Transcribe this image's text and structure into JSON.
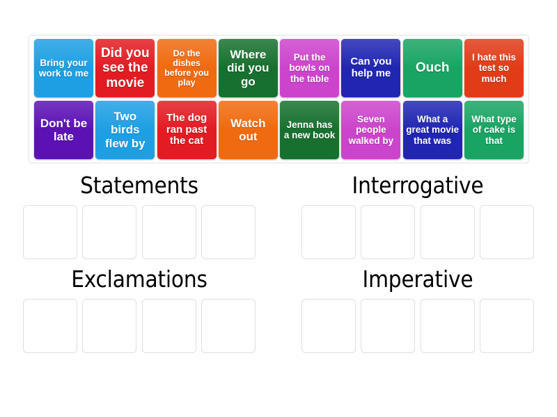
{
  "app": {
    "type": "group-sort-activity",
    "background_color": "#ffffff"
  },
  "tray": {
    "name": "answer-tile-tray",
    "rows": [
      [
        {
          "text": "Bring your work to me",
          "color": "#1e9fe3",
          "size": "fs-sm"
        },
        {
          "text": "Did you see the movie",
          "color": "#e31b23",
          "size": "fs-xl"
        },
        {
          "text": "Do the dishes before you play",
          "color": "#f06a0f",
          "size": "fs-xs"
        },
        {
          "text": "Where did you go",
          "color": "#17702f",
          "size": "fs-lg"
        },
        {
          "text": "Put the bowls on the table",
          "color": "#cc44cc",
          "size": "fs-sm"
        },
        {
          "text": "Can you help me",
          "color": "#2026b2",
          "size": "fs-md"
        },
        {
          "text": "Ouch",
          "color": "#19a463",
          "size": "fs-xl"
        },
        {
          "text": "I hate this test so much",
          "color": "#e13b17",
          "size": "fs-sm"
        }
      ],
      [
        {
          "text": "Don't be late",
          "color": "#5c11b5",
          "size": "fs-lg"
        },
        {
          "text": "Two birds flew by",
          "color": "#1e9fe3",
          "size": "fs-lg"
        },
        {
          "text": "The dog ran past the cat",
          "color": "#e31b23",
          "size": "fs-md"
        },
        {
          "text": "Watch out",
          "color": "#f06a0f",
          "size": "fs-lg"
        },
        {
          "text": "Jenna has a new book",
          "color": "#17702f",
          "size": "fs-sm"
        },
        {
          "text": "Seven people walked by",
          "color": "#cc44cc",
          "size": "fs-sm"
        },
        {
          "text": "What a great movie that was",
          "color": "#2026b2",
          "size": "fs-sm"
        },
        {
          "text": "What type of cake is that",
          "color": "#19a463",
          "size": "fs-sm"
        }
      ]
    ]
  },
  "groups": [
    {
      "title": "Statements",
      "slot_count": 4,
      "slots": [
        "",
        "",
        "",
        ""
      ]
    },
    {
      "title": "Interrogative",
      "slot_count": 4,
      "slots": [
        "",
        "",
        "",
        ""
      ]
    },
    {
      "title": "Exclamations",
      "slot_count": 4,
      "slots": [
        "",
        "",
        "",
        ""
      ]
    },
    {
      "title": "Imperative",
      "slot_count": 4,
      "slots": [
        "",
        "",
        "",
        ""
      ]
    }
  ],
  "colors": {
    "slot_border": "#dfdfdf",
    "tray_border": "#e3e3e3",
    "title_text": "#000000",
    "tile_text": "#ffffff"
  }
}
